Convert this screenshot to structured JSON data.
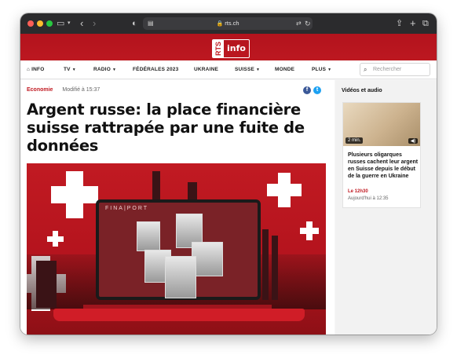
{
  "browser": {
    "url": "rts.ch",
    "colors": {
      "toolbar": "#2b2b2d",
      "close": "#fe5f57",
      "minimize": "#febc2e",
      "maximize": "#28c840"
    }
  },
  "site": {
    "logo_rts": "RTS",
    "logo_info": "info",
    "brand_color": "#c11a22"
  },
  "nav": {
    "items": [
      {
        "label": "INFO",
        "icon": "home-icon"
      },
      {
        "label": "TV",
        "has_caret": true
      },
      {
        "label": "RADIO",
        "has_caret": true
      },
      {
        "label": "FÉDÉRALES 2023"
      },
      {
        "label": "UKRAINE"
      },
      {
        "label": "SUISSE",
        "has_caret": true
      },
      {
        "label": "MONDE"
      },
      {
        "label": "PLUS",
        "has_caret": true
      }
    ],
    "search_placeholder": "Rechercher"
  },
  "article": {
    "category": "Economie",
    "modified": "Modifié à 15:37",
    "headline": "Argent russe: la place financière suisse rattrapée par une fuite de données",
    "image_text": "FINA|PORT"
  },
  "sidebar": {
    "title": "Vidéos et audio",
    "card": {
      "duration": "2 min.",
      "title": "Plusieurs oligarques russes cachent leur argent en Suisse depuis le début de la guerre en Ukraine",
      "time": "Le 12h30",
      "date": "Aujourd'hui à 12:35"
    }
  }
}
